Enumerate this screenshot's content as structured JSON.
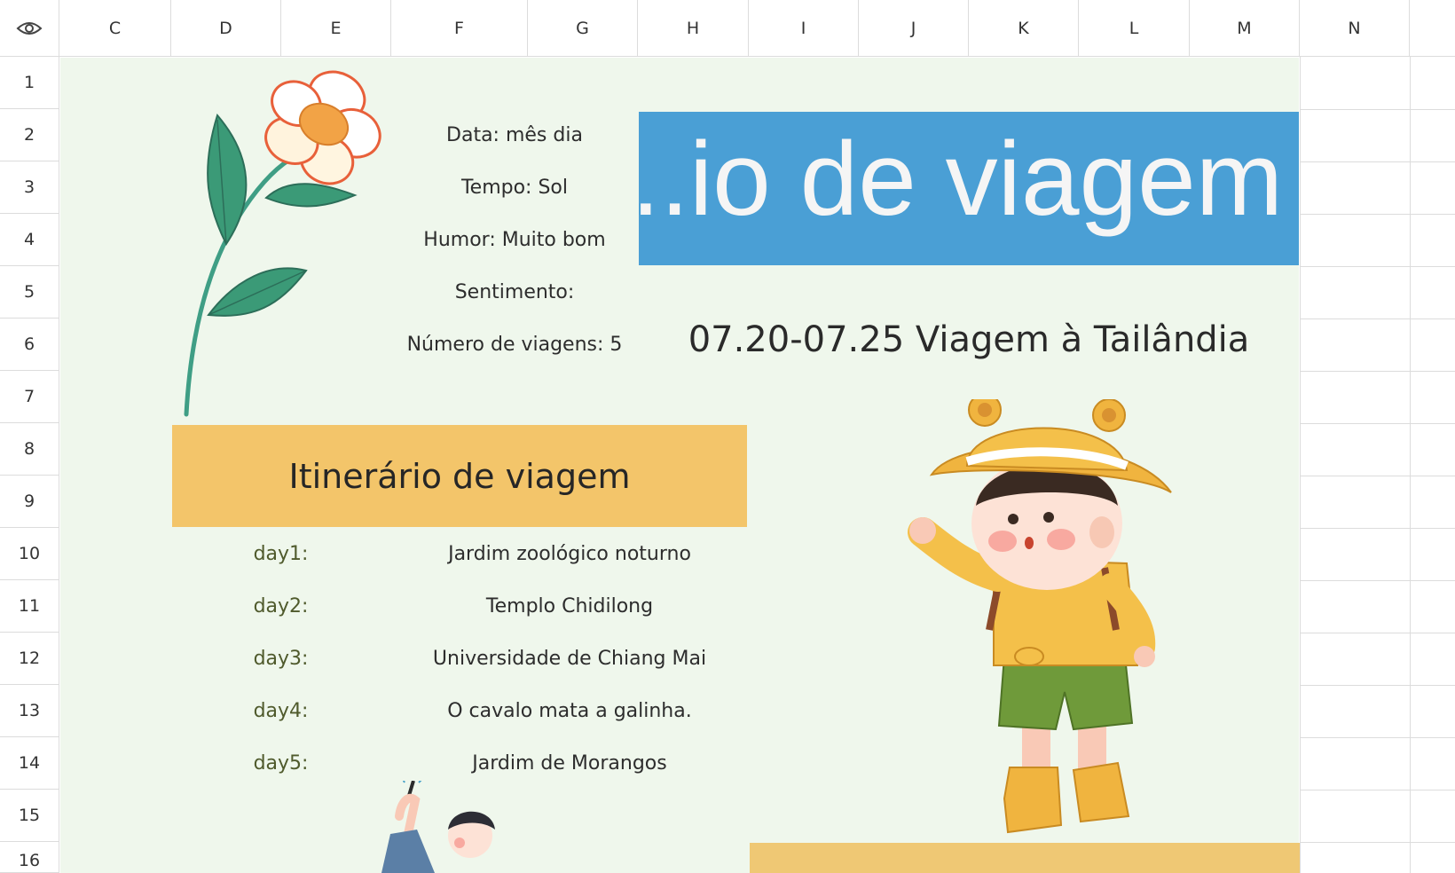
{
  "sheet": {
    "columns": [
      "C",
      "D",
      "E",
      "F",
      "G",
      "H",
      "I",
      "J",
      "K",
      "L",
      "M",
      "N"
    ],
    "rows": [
      "1",
      "2",
      "3",
      "4",
      "5",
      "6",
      "7",
      "8",
      "9",
      "10",
      "11",
      "12",
      "13",
      "14",
      "15",
      "16"
    ]
  },
  "info": {
    "date": "Data: mês dia",
    "weather": "Tempo: Sol",
    "mood": "Humor: Muito bom",
    "feeling": "Sentimento:",
    "trips": "Número de viagens: 5"
  },
  "title": "...io de viagem",
  "subtitle": "07.20-07.25 Viagem à Tailândia",
  "itinerary": {
    "heading": "Itinerário de viagem",
    "days": [
      {
        "label": "day1:",
        "place": "Jardim zoológico noturno"
      },
      {
        "label": "day2:",
        "place": "Templo Chidilong"
      },
      {
        "label": "day3:",
        "place": "Universidade de Chiang Mai"
      },
      {
        "label": "day4:",
        "place": "O cavalo mata a galinha."
      },
      {
        "label": "day5:",
        "place": "Jardim de Morangos"
      }
    ]
  },
  "colors": {
    "background": "#eff7ec",
    "title_bg": "#4a9fd5",
    "heading_bg": "#f3c56a"
  }
}
